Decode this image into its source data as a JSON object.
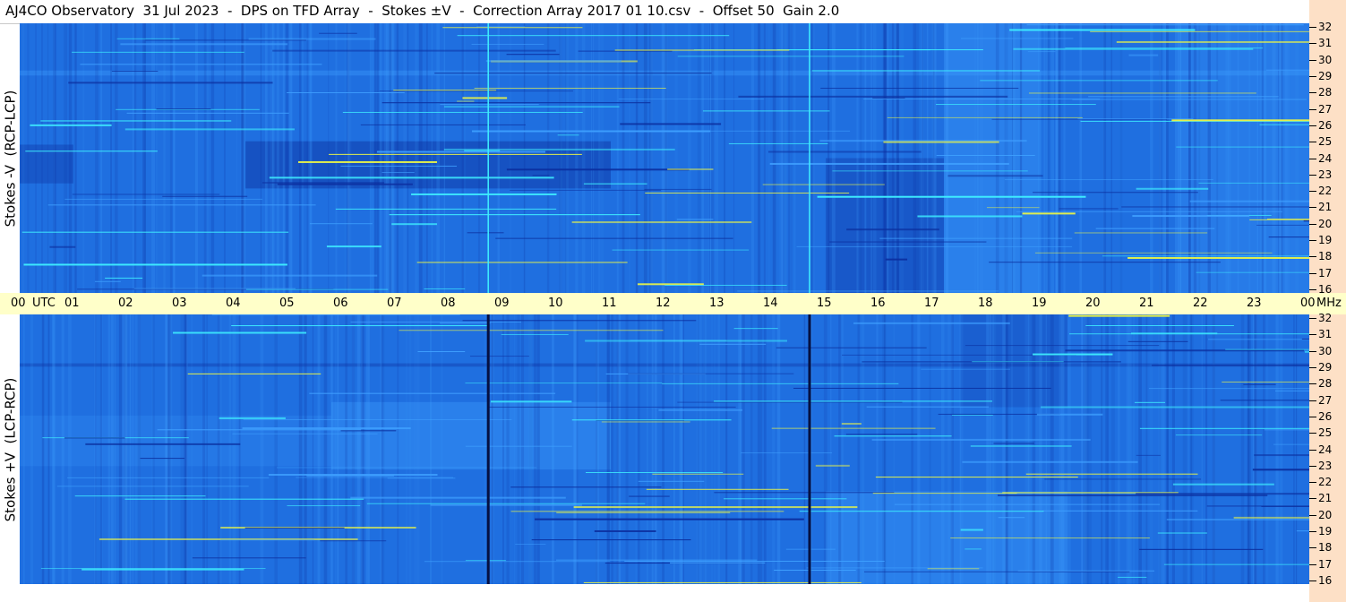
{
  "title": "AJ4CO Observatory  31 Jul 2023  -  DPS on TFD Array  -  Stokes ±V  -  Correction Array 2017 01 10.csv  -  Offset 50  Gain 2.0",
  "colors": {
    "base_blue": "#1f6fe0",
    "light_blue": "#3fa0ff",
    "cyan": "#3ff0ff",
    "dark_blue": "#0b2e9e",
    "yellow_line": "#e6f24a",
    "axis_bg": "#ffffc9",
    "right_bg": "#fde0c6"
  },
  "chart_data": [
    {
      "type": "heatmap",
      "name_label": "Stokes -V  (RCP-LCP)",
      "xlabel": "UTC",
      "ylabel": "MHz",
      "x_ticks": [
        "00",
        "01",
        "02",
        "03",
        "04",
        "05",
        "06",
        "07",
        "08",
        "09",
        "10",
        "11",
        "12",
        "13",
        "14",
        "15",
        "16",
        "17",
        "18",
        "19",
        "20",
        "21",
        "22",
        "23",
        "00"
      ],
      "y_ticks": [
        32,
        31,
        30,
        29,
        28,
        27,
        26,
        25,
        24,
        23,
        22,
        21,
        20,
        19,
        18,
        17,
        16
      ],
      "ylim": [
        16,
        32
      ],
      "xlim": [
        0,
        24
      ],
      "vertical_lines_utc": [
        8.72,
        14.7
      ],
      "vertical_line_color": "#3ff0ff"
    },
    {
      "type": "heatmap",
      "name_label": "Stokes +V  (LCP-RCP)",
      "xlabel": "UTC",
      "ylabel": "MHz",
      "x_ticks": [
        "00",
        "01",
        "02",
        "03",
        "04",
        "05",
        "06",
        "07",
        "08",
        "09",
        "10",
        "11",
        "12",
        "13",
        "14",
        "15",
        "16",
        "17",
        "18",
        "19",
        "20",
        "21",
        "22",
        "23",
        "00"
      ],
      "y_ticks": [
        32,
        31,
        30,
        29,
        28,
        27,
        26,
        25,
        24,
        23,
        22,
        21,
        20,
        19,
        18,
        17,
        16
      ],
      "ylim": [
        16,
        32
      ],
      "xlim": [
        0,
        24
      ],
      "vertical_lines_utc": [
        8.72,
        14.7
      ],
      "vertical_line_color": "#061040"
    }
  ],
  "time_axis": {
    "utc_label": "UTC",
    "mhz_label": "MHz"
  }
}
